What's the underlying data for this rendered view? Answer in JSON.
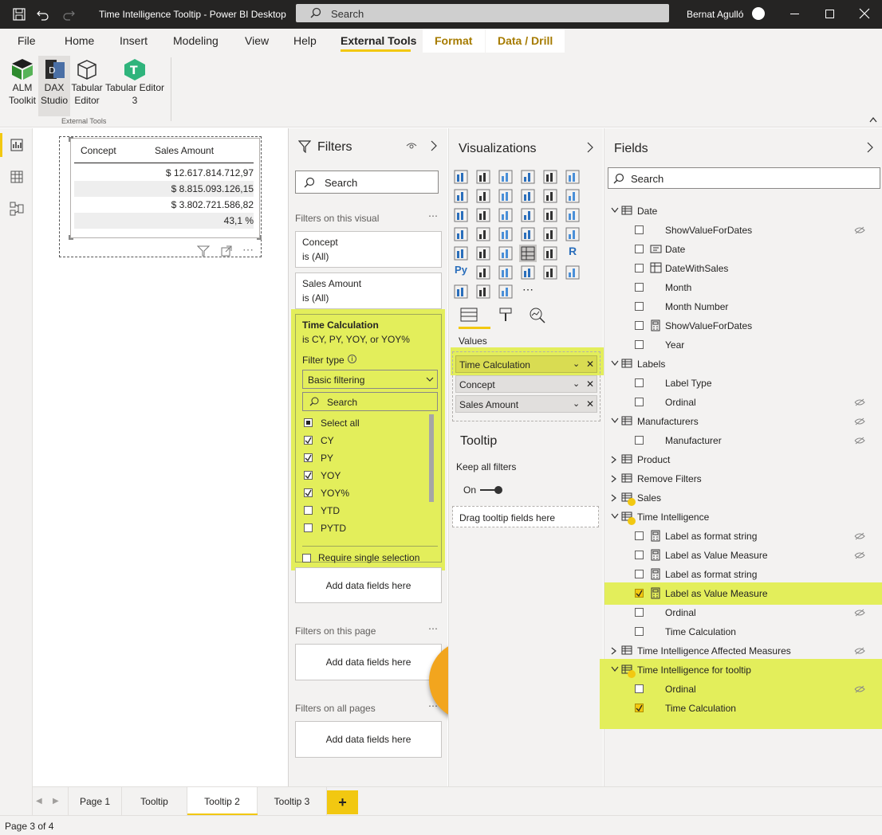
{
  "window": {
    "title": "Time Intelligence Tooltip - Power BI Desktop",
    "search_placeholder": "Search",
    "user": "Bernat Agulló"
  },
  "ribbon": {
    "tabs": [
      "File",
      "Home",
      "Insert",
      "Modeling",
      "View",
      "Help",
      "External Tools",
      "Format",
      "Data / Drill"
    ],
    "active_tab": "External Tools",
    "tools": [
      {
        "line1": "ALM",
        "line2": "Toolkit"
      },
      {
        "line1": "DAX",
        "line2": "Studio"
      },
      {
        "line1": "Tabular",
        "line2": "Editor"
      },
      {
        "line1": "Tabular Editor",
        "line2": "3"
      }
    ],
    "group_label": "External Tools"
  },
  "visual": {
    "headers": [
      "Concept",
      "Sales Amount"
    ],
    "values": [
      "$ 12.617.814.712,97",
      "$ 8.815.093.126,15",
      "$ 3.802.721.586,82",
      "43,1 %"
    ]
  },
  "filters": {
    "title": "Filters",
    "search": "Search",
    "on_visual_label": "Filters on this visual",
    "cards": [
      {
        "name": "Concept",
        "state": "is (All)"
      },
      {
        "name": "Sales Amount",
        "state": "is (All)"
      }
    ],
    "time_calc": {
      "name": "Time Calculation",
      "state": "is CY, PY, YOY, or YOY%",
      "filter_type_label": "Filter type",
      "filter_type_value": "Basic filtering",
      "search": "Search",
      "items": [
        "Select all",
        "CY",
        "PY",
        "YOY",
        "YOY%",
        "YTD",
        "PYTD"
      ],
      "checked": [
        true,
        true,
        true,
        true,
        true,
        false,
        false
      ],
      "require_single": "Require single selection"
    },
    "add_fields": "Add data fields here",
    "on_page_label": "Filters on this page",
    "all_pages_label": "Filters on all pages"
  },
  "viz": {
    "title": "Visualizations",
    "values_label": "Values",
    "wells": [
      "Time Calculation",
      "Concept",
      "Sales Amount"
    ],
    "tooltip_title": "Tooltip",
    "keep_filters": "Keep all filters",
    "toggle": "On",
    "drag_tooltip": "Drag tooltip fields here"
  },
  "fields": {
    "title": "Fields",
    "search": "Search",
    "rows": [
      {
        "label": "Date",
        "kind": "table",
        "expanded": true
      },
      {
        "label": "ShowValueForDates",
        "kind": "field",
        "icon": "none",
        "hidden": true
      },
      {
        "label": "Date",
        "kind": "field",
        "icon": "card"
      },
      {
        "label": "DateWithSales",
        "kind": "field",
        "icon": "calc"
      },
      {
        "label": "Month",
        "kind": "field",
        "icon": "none"
      },
      {
        "label": "Month Number",
        "kind": "field",
        "icon": "none"
      },
      {
        "label": "ShowValueForDates",
        "kind": "field",
        "icon": "measure"
      },
      {
        "label": "Year",
        "kind": "field",
        "icon": "none"
      },
      {
        "label": "Labels",
        "kind": "table",
        "expanded": true
      },
      {
        "label": "Label Type",
        "kind": "field",
        "icon": "none"
      },
      {
        "label": "Ordinal",
        "kind": "field",
        "icon": "none",
        "hidden": true
      },
      {
        "label": "Manufacturers",
        "kind": "table",
        "expanded": true,
        "hidden": true
      },
      {
        "label": "Manufacturer",
        "kind": "field",
        "icon": "none",
        "hidden": true
      },
      {
        "label": "Product",
        "kind": "table",
        "expanded": false
      },
      {
        "label": "Remove Filters",
        "kind": "table",
        "expanded": false
      },
      {
        "label": "Sales",
        "kind": "table",
        "expanded": false,
        "check": true
      },
      {
        "label": "Time Intelligence",
        "kind": "table",
        "expanded": true,
        "check": true
      },
      {
        "label": "Label as format string",
        "kind": "field",
        "icon": "measure",
        "hidden": true
      },
      {
        "label": "Label as Value Measure",
        "kind": "field",
        "icon": "measure",
        "hidden": true
      },
      {
        "label": "Label as format string",
        "kind": "field",
        "icon": "measure"
      },
      {
        "label": "Label as Value Measure",
        "kind": "field",
        "icon": "measure",
        "checked": true,
        "highlight": true
      },
      {
        "label": "Ordinal",
        "kind": "field",
        "icon": "none",
        "hidden": true
      },
      {
        "label": "Time Calculation",
        "kind": "field",
        "icon": "none"
      },
      {
        "label": "Time Intelligence Affected Measures",
        "kind": "table",
        "expanded": false,
        "hidden": true
      },
      {
        "label": "Time Intelligence for tooltip",
        "kind": "table",
        "expanded": true,
        "check": true,
        "highlight": true
      },
      {
        "label": "Ordinal",
        "kind": "field",
        "icon": "none",
        "hidden": true,
        "highlight": true
      },
      {
        "label": "Time Calculation",
        "kind": "field",
        "icon": "none",
        "checked": true,
        "highlight": true
      }
    ]
  },
  "pages": {
    "tabs": [
      "Page 1",
      "Tooltip",
      "Tooltip 2",
      "Tooltip 3"
    ],
    "active": "Tooltip 2",
    "add": "+"
  },
  "status": "Page 3 of 4",
  "colors": {
    "accent": "#f2c811",
    "highlight": "#e3ee5b",
    "titlebar": "#252423"
  }
}
